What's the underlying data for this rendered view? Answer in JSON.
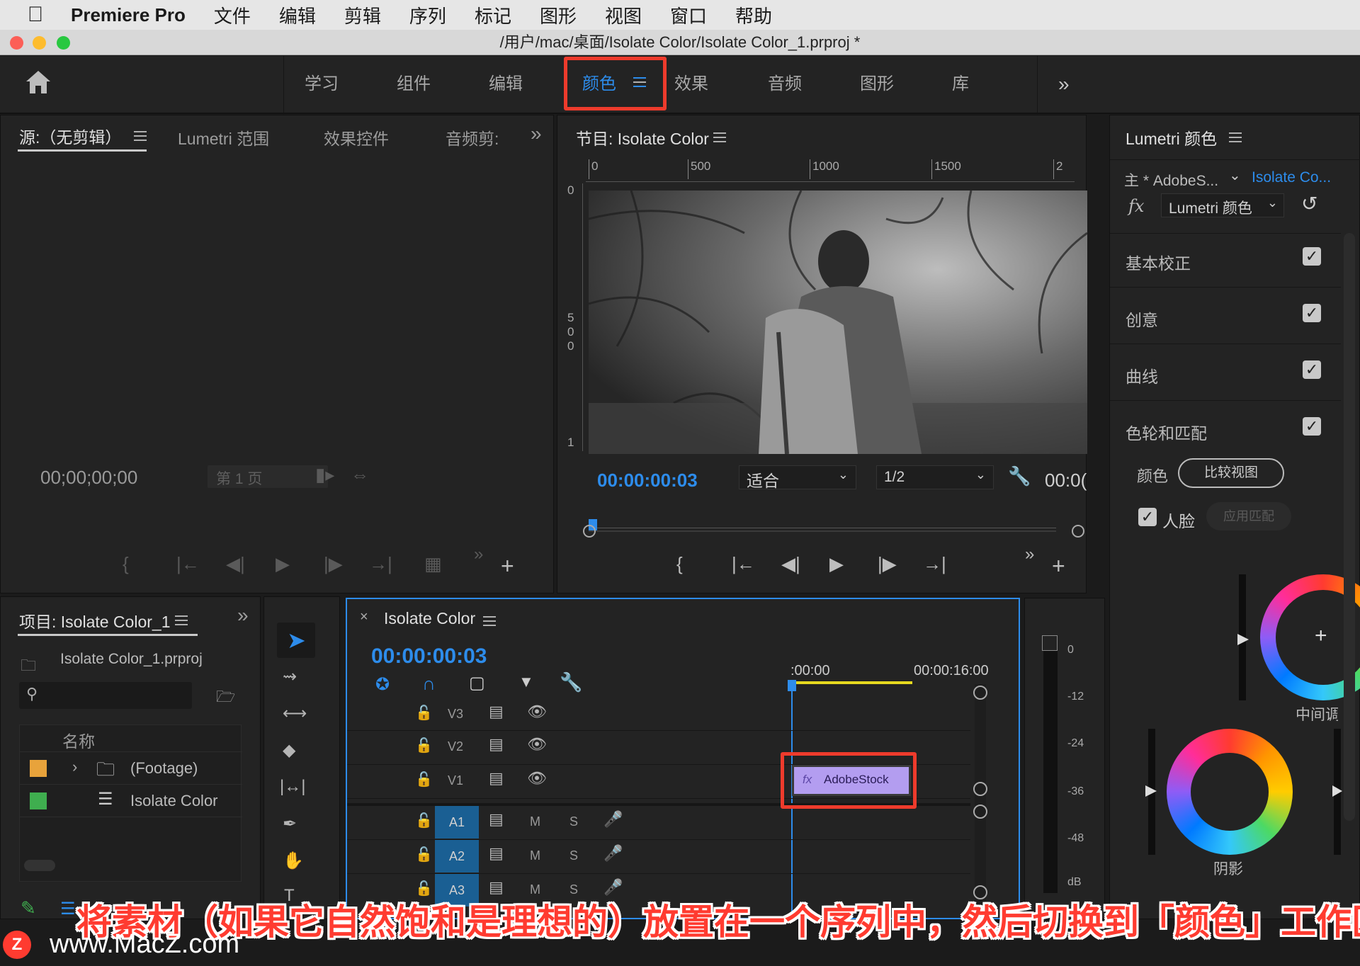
{
  "menubar": {
    "app_name": "Premiere Pro",
    "items": [
      "文件",
      "编辑",
      "剪辑",
      "序列",
      "标记",
      "图形",
      "视图",
      "窗口",
      "帮助"
    ]
  },
  "titlebar": {
    "path": "/用户/mac/桌面/Isolate Color/Isolate Color_1.prproj *"
  },
  "workspaces": {
    "items": [
      "学习",
      "组件",
      "编辑",
      "颜色",
      "效果",
      "音频",
      "图形",
      "库"
    ],
    "active": "颜色",
    "overflow_icon": "double-chevron-right-icon"
  },
  "source_panel": {
    "tabs": [
      "源:（无剪辑）",
      "Lumetri 范围",
      "效果控件",
      "音频剪:"
    ],
    "timecode": "00;00;00;00",
    "page_label": "第 1 页"
  },
  "program_panel": {
    "title": "节目: Isolate Color",
    "ruler_ticks": [
      "0",
      "500",
      "1000",
      "1500",
      "2"
    ],
    "vruler_ticks": [
      "0",
      "5",
      "0",
      "0",
      "1"
    ],
    "timecode": "00:00:00:03",
    "fit": "适合",
    "resolution": "1/2",
    "end_timecode": "00:0("
  },
  "lumetri_panel": {
    "title": "Lumetri 颜色",
    "master": "主 * AdobeS...",
    "clip": "Isolate Co...",
    "effect": "Lumetri 颜色",
    "sections": [
      {
        "label": "基本校正",
        "checked": true
      },
      {
        "label": "创意",
        "checked": true
      },
      {
        "label": "曲线",
        "checked": true
      },
      {
        "label": "色轮和匹配",
        "checked": true
      }
    ],
    "color_label": "颜色",
    "compare_button": "比较视图",
    "face_label": "人脸",
    "apply_match": "应用匹配",
    "wheel_midtones": "中间调",
    "wheel_shadows": "阴影"
  },
  "project_panel": {
    "title": "项目: Isolate Color_1",
    "file": "Isolate Color_1.prproj",
    "search_placeholder": "",
    "column_name": "名称",
    "items": [
      {
        "name": "(Footage)",
        "color": "#e8a33b",
        "type": "folder"
      },
      {
        "name": "Isolate Color",
        "color": "#3fae4f",
        "type": "sequence"
      }
    ]
  },
  "timeline": {
    "title": "Isolate Color",
    "timecode": "00:00:00:03",
    "ruler": [
      ":00:00",
      "00:00:16:00"
    ],
    "video_tracks": [
      "V3",
      "V2",
      "V1"
    ],
    "audio_tracks": [
      "A1",
      "A2",
      "A3"
    ],
    "mute_label": "M",
    "solo_label": "S",
    "clip": "AdobeStock"
  },
  "audio_meter": {
    "scale": [
      "0",
      "-12",
      "-24",
      "-36",
      "-48",
      "dB"
    ]
  },
  "caption": "将素材（如果它自然饱和是理想的）放置在一个序列中，然后切换到「颜色」工作区",
  "watermark": "www.MacZ.com"
}
